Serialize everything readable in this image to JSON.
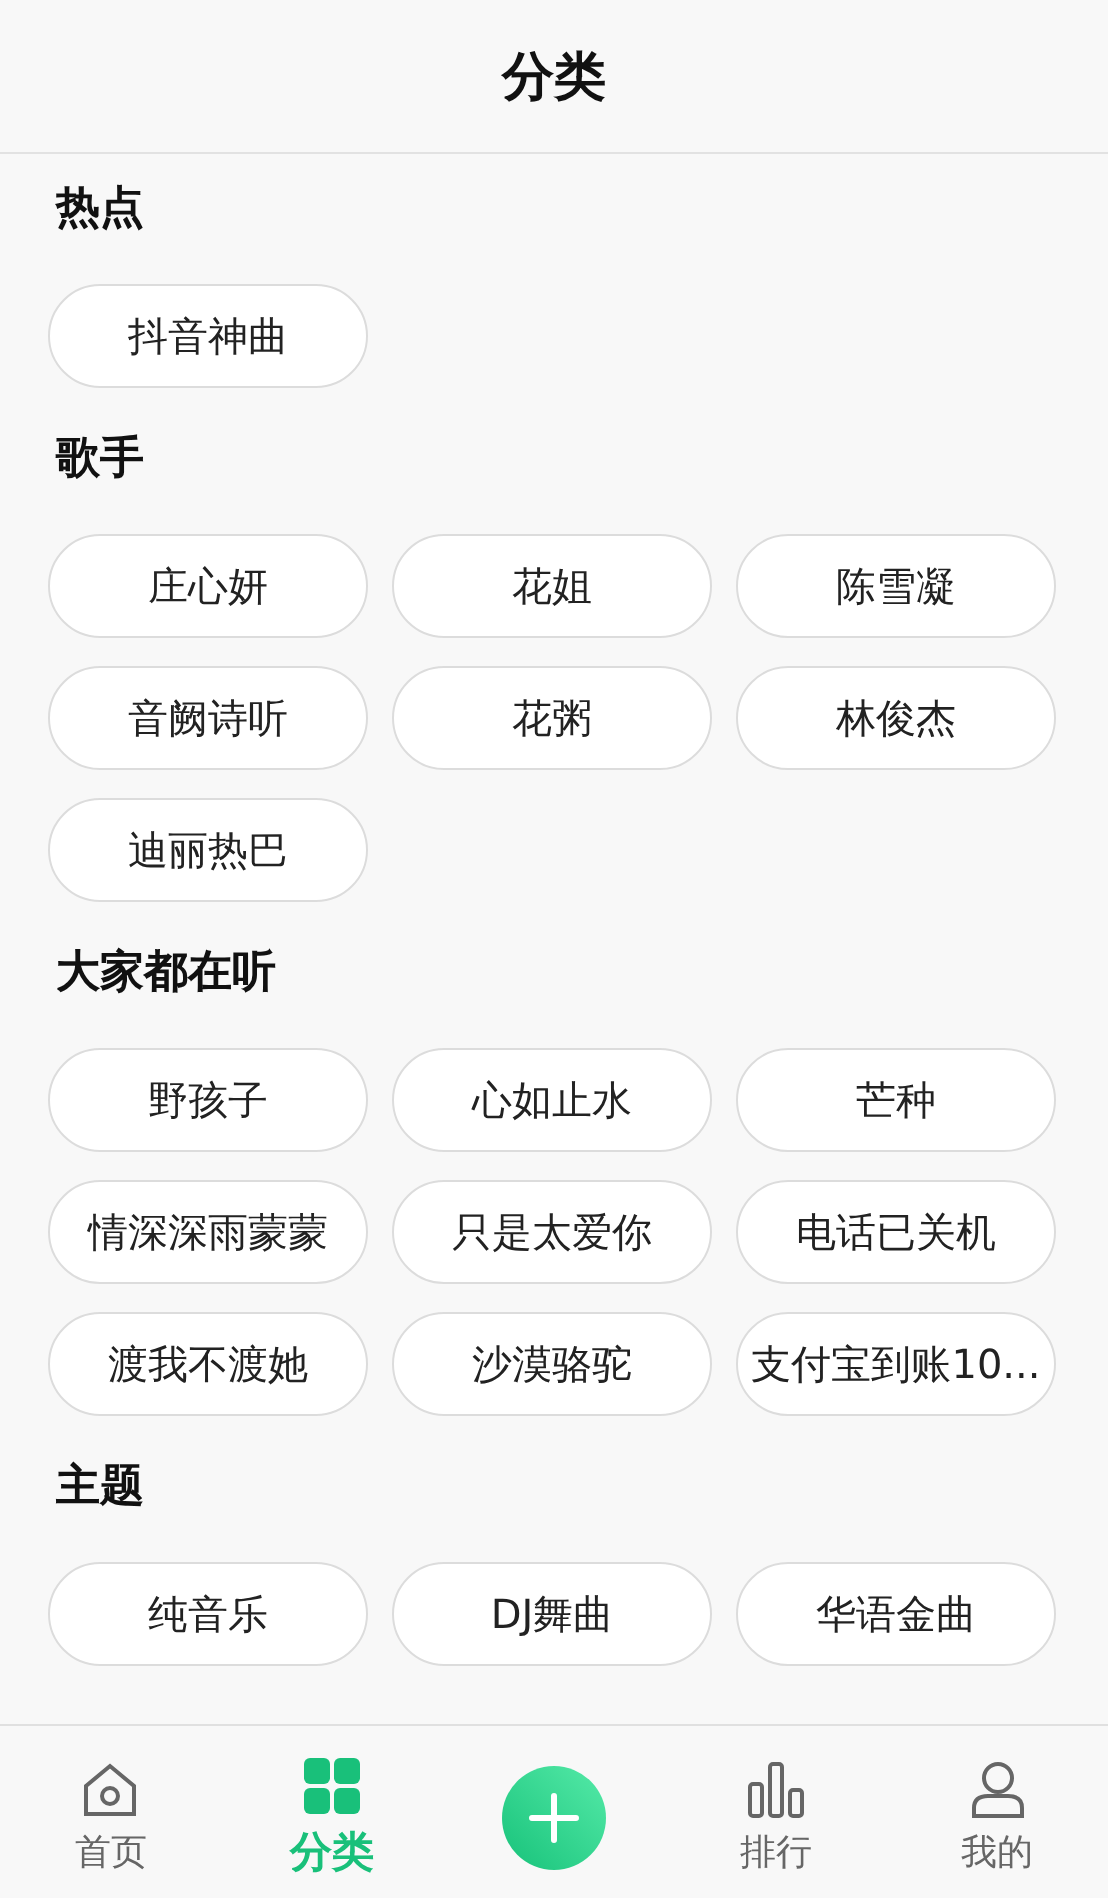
{
  "header": {
    "title": "分类"
  },
  "sections": [
    {
      "title": "热点",
      "tags": [
        "抖音神曲"
      ]
    },
    {
      "title": "歌手",
      "tags": [
        "庄心妍",
        "花姐",
        "陈雪凝",
        "音阙诗听",
        "花粥",
        "林俊杰",
        "迪丽热巴"
      ]
    },
    {
      "title": "大家都在听",
      "tags": [
        "野孩子",
        "心如止水",
        "芒种",
        "情深深雨蒙蒙",
        "只是太爱你",
        "电话已关机",
        "渡我不渡她",
        "沙漠骆驼",
        "支付宝到账10..."
      ]
    },
    {
      "title": "主题",
      "tags": [
        "纯音乐",
        "DJ舞曲",
        "华语金曲"
      ]
    }
  ],
  "nav": [
    {
      "kind": "home",
      "label": "首页",
      "selected": false
    },
    {
      "kind": "grid",
      "label": "分类",
      "selected": true
    },
    {
      "kind": "add"
    },
    {
      "kind": "chart",
      "label": "排行",
      "selected": false
    },
    {
      "kind": "user",
      "label": "我的",
      "selected": false
    }
  ]
}
